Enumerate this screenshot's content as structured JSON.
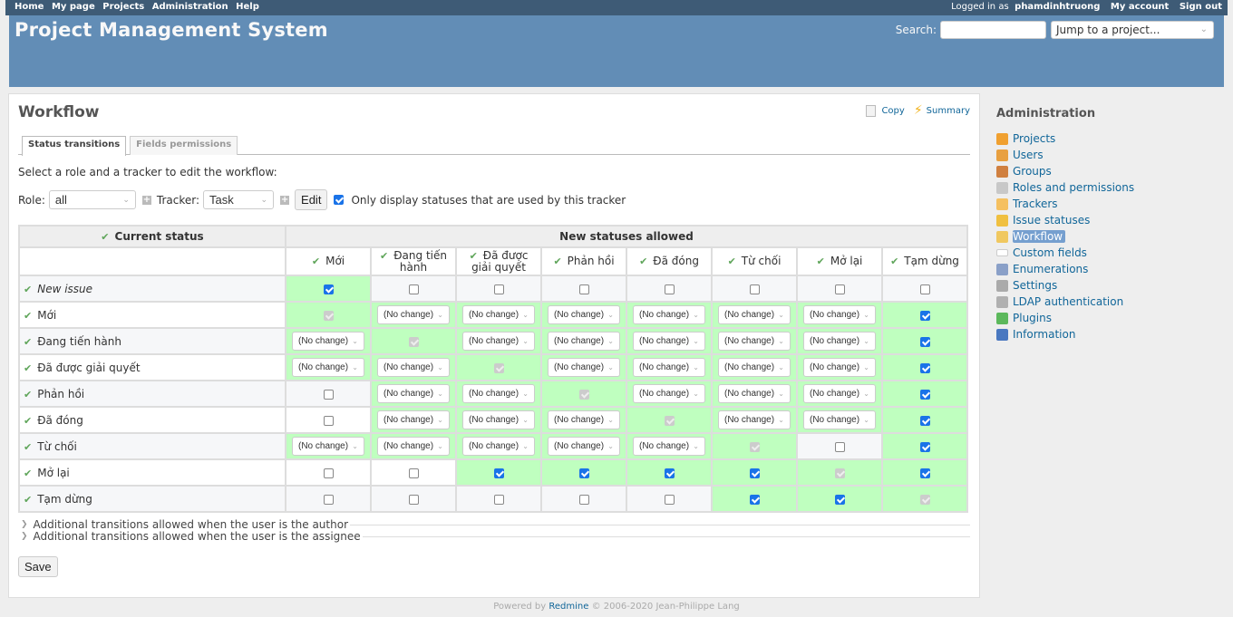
{
  "top_menu": {
    "left": [
      "Home",
      "My page",
      "Projects",
      "Administration",
      "Help"
    ],
    "logged_in_prefix": "Logged in as",
    "username": "phamdinhtruong",
    "right": [
      "My account",
      "Sign out"
    ]
  },
  "header": {
    "title": "Project Management System",
    "search_label": "Search:",
    "search_value": "",
    "jump_placeholder": "Jump to a project..."
  },
  "content": {
    "title": "Workflow",
    "actions": {
      "copy": "Copy",
      "summary": "Summary"
    },
    "tabs": [
      {
        "label": "Status transitions",
        "selected": true
      },
      {
        "label": "Fields permissions",
        "selected": false
      }
    ],
    "intro": "Select a role and a tracker to edit the workflow:",
    "filters": {
      "role_label": "Role:",
      "role_value": "all",
      "tracker_label": "Tracker:",
      "tracker_value": "Task",
      "edit_button": "Edit",
      "only_used_label": "Only display statuses that are used by this tracker",
      "only_used_checked": true
    },
    "table": {
      "current_status_header": "Current status",
      "new_statuses_header": "New statuses allowed",
      "columns": [
        "Mới",
        "Đang tiến hành",
        "Đã được giải quyết",
        "Phản hồi",
        "Đã đóng",
        "Từ chối",
        "Mở lại",
        "Tạm dừng"
      ],
      "no_change_label": "(No change)",
      "rows": [
        {
          "name": "New issue",
          "italic": true,
          "cells": [
            {
              "t": "check",
              "on": true,
              "g": true
            },
            {
              "t": "check",
              "on": false,
              "g": false
            },
            {
              "t": "check",
              "on": false,
              "g": false
            },
            {
              "t": "check",
              "on": false,
              "g": false
            },
            {
              "t": "check",
              "on": false,
              "g": false
            },
            {
              "t": "check",
              "on": false,
              "g": false
            },
            {
              "t": "check",
              "on": false,
              "g": false
            },
            {
              "t": "check",
              "on": false,
              "g": false
            }
          ]
        },
        {
          "name": "Mới",
          "cells": [
            {
              "t": "disabled",
              "g": true
            },
            {
              "t": "select",
              "g": true
            },
            {
              "t": "select",
              "g": true
            },
            {
              "t": "select",
              "g": true
            },
            {
              "t": "select",
              "g": true
            },
            {
              "t": "select",
              "g": true
            },
            {
              "t": "select",
              "g": true
            },
            {
              "t": "check",
              "on": true,
              "g": true
            }
          ]
        },
        {
          "name": "Đang tiến hành",
          "cells": [
            {
              "t": "select",
              "g": true
            },
            {
              "t": "disabled",
              "g": true
            },
            {
              "t": "select",
              "g": true
            },
            {
              "t": "select",
              "g": true
            },
            {
              "t": "select",
              "g": true
            },
            {
              "t": "select",
              "g": true
            },
            {
              "t": "select",
              "g": true
            },
            {
              "t": "check",
              "on": true,
              "g": true
            }
          ]
        },
        {
          "name": "Đã được giải quyết",
          "cells": [
            {
              "t": "select",
              "g": true
            },
            {
              "t": "select",
              "g": true
            },
            {
              "t": "disabled",
              "g": true
            },
            {
              "t": "select",
              "g": true
            },
            {
              "t": "select",
              "g": true
            },
            {
              "t": "select",
              "g": true
            },
            {
              "t": "select",
              "g": true
            },
            {
              "t": "check",
              "on": true,
              "g": true
            }
          ]
        },
        {
          "name": "Phản hồi",
          "cells": [
            {
              "t": "check",
              "on": false,
              "g": false
            },
            {
              "t": "select",
              "g": true
            },
            {
              "t": "select",
              "g": true
            },
            {
              "t": "disabled",
              "g": true
            },
            {
              "t": "select",
              "g": true
            },
            {
              "t": "select",
              "g": true
            },
            {
              "t": "select",
              "g": true
            },
            {
              "t": "check",
              "on": true,
              "g": true
            }
          ]
        },
        {
          "name": "Đã đóng",
          "cells": [
            {
              "t": "check",
              "on": false,
              "g": false
            },
            {
              "t": "select",
              "g": true
            },
            {
              "t": "select",
              "g": true
            },
            {
              "t": "select",
              "g": true
            },
            {
              "t": "disabled",
              "g": true
            },
            {
              "t": "select",
              "g": true
            },
            {
              "t": "select",
              "g": true
            },
            {
              "t": "check",
              "on": true,
              "g": true
            }
          ]
        },
        {
          "name": "Từ chối",
          "cells": [
            {
              "t": "select",
              "g": true
            },
            {
              "t": "select",
              "g": true
            },
            {
              "t": "select",
              "g": true
            },
            {
              "t": "select",
              "g": true
            },
            {
              "t": "select",
              "g": true
            },
            {
              "t": "disabled",
              "g": true
            },
            {
              "t": "check",
              "on": false,
              "g": false
            },
            {
              "t": "check",
              "on": true,
              "g": true
            }
          ]
        },
        {
          "name": "Mở lại",
          "cells": [
            {
              "t": "check",
              "on": false,
              "g": false
            },
            {
              "t": "check",
              "on": false,
              "g": false
            },
            {
              "t": "check",
              "on": true,
              "g": true
            },
            {
              "t": "check",
              "on": true,
              "g": true
            },
            {
              "t": "check",
              "on": true,
              "g": true
            },
            {
              "t": "check",
              "on": true,
              "g": true
            },
            {
              "t": "disabled",
              "g": true
            },
            {
              "t": "check",
              "on": true,
              "g": true
            }
          ]
        },
        {
          "name": "Tạm dừng",
          "cells": [
            {
              "t": "check",
              "on": false,
              "g": false
            },
            {
              "t": "check",
              "on": false,
              "g": false
            },
            {
              "t": "check",
              "on": false,
              "g": false
            },
            {
              "t": "check",
              "on": false,
              "g": false
            },
            {
              "t": "check",
              "on": false,
              "g": false
            },
            {
              "t": "check",
              "on": true,
              "g": true
            },
            {
              "t": "check",
              "on": true,
              "g": true
            },
            {
              "t": "disabled",
              "g": true
            }
          ]
        }
      ]
    },
    "additional": [
      "Additional transitions allowed when the user is the author",
      "Additional transitions allowed when the user is the assignee"
    ],
    "save_button": "Save"
  },
  "sidebar": {
    "title": "Administration",
    "items": [
      {
        "label": "Projects",
        "icon": "projects-icon",
        "color": "#f0a030",
        "selected": false
      },
      {
        "label": "Users",
        "icon": "user-icon",
        "color": "#e8a040",
        "selected": false
      },
      {
        "label": "Groups",
        "icon": "group-icon",
        "color": "#d08040",
        "selected": false
      },
      {
        "label": "Roles and permissions",
        "icon": "database-key-icon",
        "color": "#c8c8c8",
        "selected": false
      },
      {
        "label": "Trackers",
        "icon": "tracker-icon",
        "color": "#f5c060",
        "selected": false
      },
      {
        "label": "Issue statuses",
        "icon": "issue-status-icon",
        "color": "#f0c040",
        "selected": false
      },
      {
        "label": "Workflow",
        "icon": "workflow-icon",
        "color": "#f0c860",
        "selected": true
      },
      {
        "label": "Custom fields",
        "icon": "custom-fields-icon",
        "color": "#ffffff",
        "selected": false
      },
      {
        "label": "Enumerations",
        "icon": "list-icon",
        "color": "#8aa0c8",
        "selected": false
      },
      {
        "label": "Settings",
        "icon": "gear-icon",
        "color": "#aaaaaa",
        "selected": false
      },
      {
        "label": "LDAP authentication",
        "icon": "server-key-icon",
        "color": "#b0b0b0",
        "selected": false
      },
      {
        "label": "Plugins",
        "icon": "plugin-icon",
        "color": "#5cb85c",
        "selected": false
      },
      {
        "label": "Information",
        "icon": "info-icon",
        "color": "#4a78c0",
        "selected": false
      }
    ]
  },
  "footer": {
    "powered_by": "Powered by",
    "redmine": "Redmine",
    "copyright": "© 2006-2020 Jean-Philippe Lang"
  },
  "colors": {
    "top_menu_bg": "#3e5b76",
    "header_bg": "#628db6",
    "enabled_cell": "#bfffbf",
    "checkbox_on": "#1a73e8",
    "sidebar_selected": "#759fcf"
  }
}
